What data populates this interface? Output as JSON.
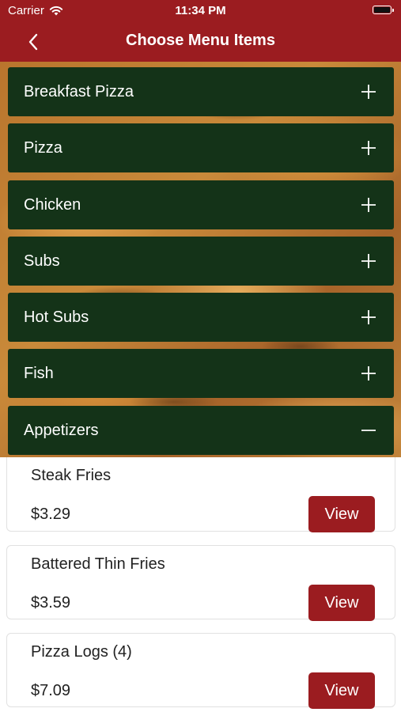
{
  "status_bar": {
    "carrier": "Carrier",
    "time": "11:34 PM"
  },
  "nav": {
    "back_icon": "chevron-left-icon",
    "title": "Choose Menu Items"
  },
  "colors": {
    "primary": "#9b1c20",
    "category_bg": "#143318",
    "text_dark": "#222222"
  },
  "categories": [
    {
      "label": "Breakfast Pizza",
      "icon": "plus-icon",
      "expanded": false
    },
    {
      "label": "Pizza",
      "icon": "plus-icon",
      "expanded": false
    },
    {
      "label": "Chicken",
      "icon": "plus-icon",
      "expanded": false
    },
    {
      "label": "Subs",
      "icon": "plus-icon",
      "expanded": false
    },
    {
      "label": "Hot Subs",
      "icon": "plus-icon",
      "expanded": false
    },
    {
      "label": "Fish",
      "icon": "plus-icon",
      "expanded": false
    },
    {
      "label": "Appetizers",
      "icon": "minus-icon",
      "expanded": true
    }
  ],
  "items": [
    {
      "name": "Steak Fries",
      "price": "$3.29",
      "button": "View"
    },
    {
      "name": "Battered Thin Fries",
      "price": "$3.59",
      "button": "View"
    },
    {
      "name": "Pizza Logs (4)",
      "price": "$7.09",
      "button": "View"
    }
  ]
}
